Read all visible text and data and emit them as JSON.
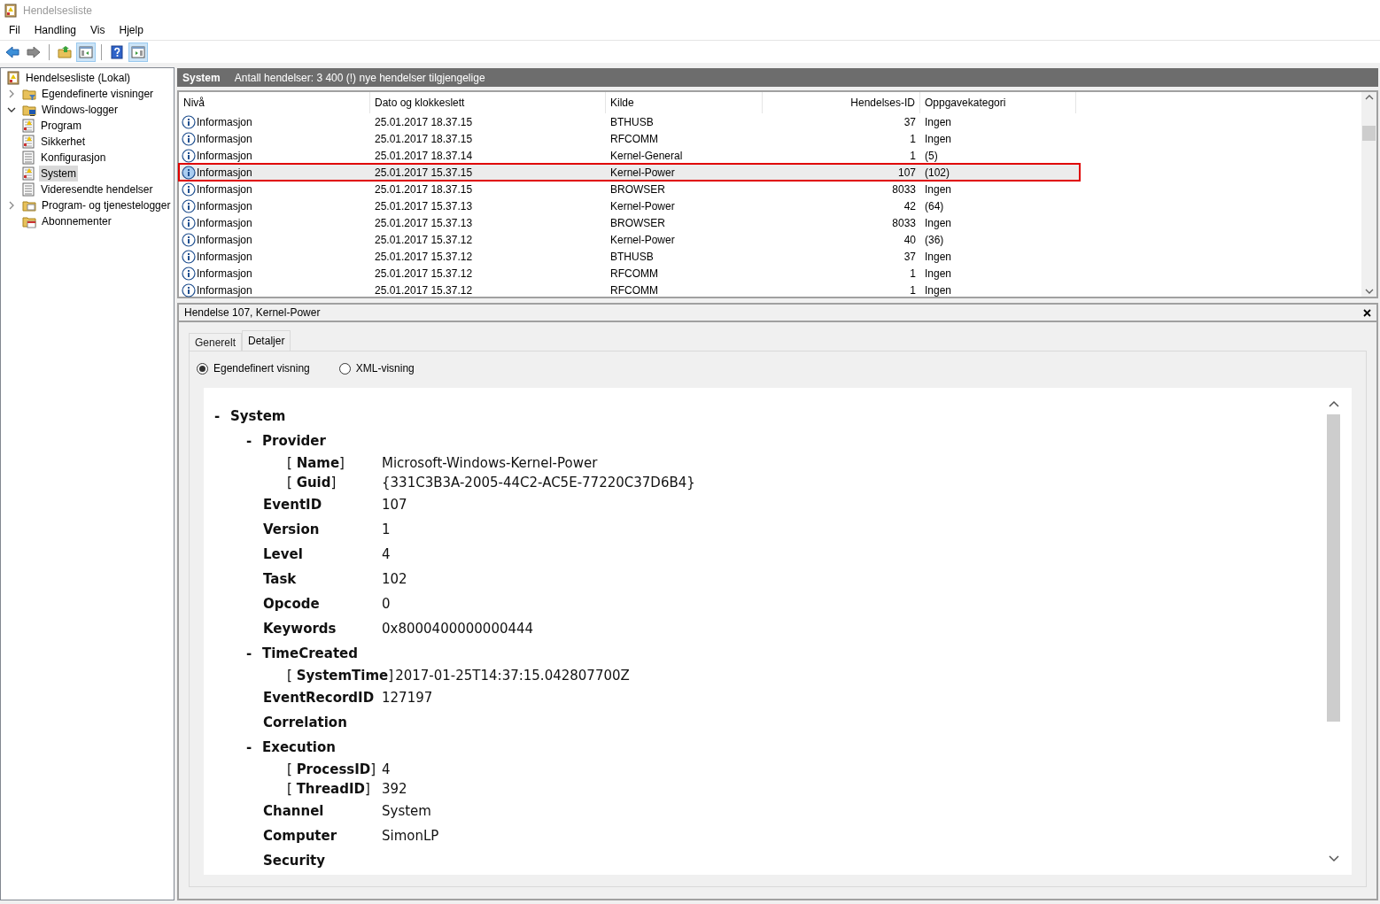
{
  "window": {
    "title": "Hendelsesliste"
  },
  "menu": [
    "Fil",
    "Handling",
    "Vis",
    "Hjelp"
  ],
  "toolbar": [
    {
      "kind": "back",
      "pressed": false
    },
    {
      "kind": "forward",
      "pressed": false
    },
    {
      "kind": "separator"
    },
    {
      "kind": "folder-up",
      "pressed": false
    },
    {
      "kind": "pane-left",
      "pressed": true
    },
    {
      "kind": "separator"
    },
    {
      "kind": "help",
      "pressed": false
    },
    {
      "kind": "pane-right",
      "pressed": true
    }
  ],
  "tree": [
    {
      "label": "Hendelsesliste (Lokal)",
      "kind": "root",
      "selected": false,
      "children": [
        {
          "label": "Egendefinerte visninger",
          "kind": "folder-filter",
          "expanded": false,
          "selected": false
        },
        {
          "label": "Windows-logger",
          "kind": "folder-windows",
          "expanded": true,
          "selected": false,
          "children": [
            {
              "label": "Program",
              "kind": "log-warning",
              "selected": false
            },
            {
              "label": "Sikkerhet",
              "kind": "log-warning",
              "selected": false
            },
            {
              "label": "Konfigurasjon",
              "kind": "log",
              "selected": false
            },
            {
              "label": "System",
              "kind": "log-warning",
              "selected": true
            },
            {
              "label": "Videresendte hendelser",
              "kind": "log",
              "selected": false
            }
          ]
        },
        {
          "label": "Program- og tjenestelogger",
          "kind": "folder",
          "expanded": false,
          "selected": false
        },
        {
          "label": "Abonnementer",
          "kind": "subscriptions",
          "selected": false
        }
      ]
    }
  ],
  "log_header": {
    "title": "System",
    "summary": "Antall hendelser: 3 400 (!) nye hendelser tilgjengelige"
  },
  "table": {
    "columns": [
      "Nivå",
      "Dato og klokkeslett",
      "Kilde",
      "Hendelses-ID",
      "Oppgavekategori"
    ],
    "rows": [
      {
        "severity": "Informasjon",
        "date": "25.01.2017 18.37.15",
        "source": "BTHUSB",
        "id": "37",
        "category": "Ingen",
        "selected": false
      },
      {
        "severity": "Informasjon",
        "date": "25.01.2017 18.37.15",
        "source": "RFCOMM",
        "id": "1",
        "category": "Ingen",
        "selected": false
      },
      {
        "severity": "Informasjon",
        "date": "25.01.2017 18.37.14",
        "source": "Kernel-General",
        "id": "1",
        "category": "(5)",
        "selected": false
      },
      {
        "severity": "Informasjon",
        "date": "25.01.2017 15.37.15",
        "source": "Kernel-Power",
        "id": "107",
        "category": "(102)",
        "selected": true
      },
      {
        "severity": "Informasjon",
        "date": "25.01.2017 18.37.15",
        "source": "BROWSER",
        "id": "8033",
        "category": "Ingen",
        "selected": false
      },
      {
        "severity": "Informasjon",
        "date": "25.01.2017 15.37.13",
        "source": "Kernel-Power",
        "id": "42",
        "category": "(64)",
        "selected": false
      },
      {
        "severity": "Informasjon",
        "date": "25.01.2017 15.37.13",
        "source": "BROWSER",
        "id": "8033",
        "category": "Ingen",
        "selected": false
      },
      {
        "severity": "Informasjon",
        "date": "25.01.2017 15.37.12",
        "source": "Kernel-Power",
        "id": "40",
        "category": "(36)",
        "selected": false
      },
      {
        "severity": "Informasjon",
        "date": "25.01.2017 15.37.12",
        "source": "BTHUSB",
        "id": "37",
        "category": "Ingen",
        "selected": false
      },
      {
        "severity": "Informasjon",
        "date": "25.01.2017 15.37.12",
        "source": "RFCOMM",
        "id": "1",
        "category": "Ingen",
        "selected": false
      },
      {
        "severity": "Informasjon",
        "date": "25.01.2017 15.37.12",
        "source": "RFCOMM",
        "id": "1",
        "category": "Ingen",
        "selected": false
      }
    ]
  },
  "detail": {
    "title": "Hendelse 107, Kernel-Power",
    "tabs": [
      {
        "label": "Generelt",
        "selected": false
      },
      {
        "label": "Detaljer",
        "selected": true
      }
    ],
    "view_options": [
      {
        "label": "Egendefinert visning",
        "selected": true
      },
      {
        "label": "XML-visning",
        "selected": false
      }
    ],
    "tree": [
      {
        "kind": "section",
        "toggle": "-",
        "name": "System",
        "children": [
          {
            "kind": "section",
            "toggle": "-",
            "name": "Provider",
            "children": [
              {
                "kind": "attribute",
                "name": "[ **Name**]",
                "value": "Microsoft-Windows-Kernel-Power"
              },
              {
                "kind": "attribute",
                "name": "[ **Guid**]",
                "value": "{331C3B3A-2005-44C2-AC5E-77220C37D6B4}"
              }
            ]
          },
          {
            "kind": "field",
            "name": "EventID",
            "value": "107"
          },
          {
            "kind": "field",
            "name": "Version",
            "value": "1"
          },
          {
            "kind": "field",
            "name": "Level",
            "value": "4"
          },
          {
            "kind": "field",
            "name": "Task",
            "value": "102"
          },
          {
            "kind": "field",
            "name": "Opcode",
            "value": "0"
          },
          {
            "kind": "field",
            "name": "Keywords",
            "value": "0x8000400000000444"
          },
          {
            "kind": "section",
            "toggle": "-",
            "name": "TimeCreated",
            "children": [
              {
                "kind": "attribute",
                "name": "[ **SystemTime**]",
                "value": "2017-01-25T14:37:15.042807700Z"
              }
            ]
          },
          {
            "kind": "field",
            "name": "EventRecordID",
            "value": "127197"
          },
          {
            "kind": "field",
            "name": "Correlation"
          },
          {
            "kind": "section",
            "toggle": "-",
            "name": "Execution",
            "children": [
              {
                "kind": "attribute",
                "name": "[ **ProcessID**]",
                "value": "4"
              },
              {
                "kind": "attribute",
                "name": "[ **ThreadID**]",
                "value": "392"
              }
            ]
          },
          {
            "kind": "field",
            "name": "Channel",
            "value": "System"
          },
          {
            "kind": "field",
            "name": "Computer",
            "value": "SimonLP"
          },
          {
            "kind": "field",
            "name": "Security"
          }
        ]
      }
    ]
  }
}
